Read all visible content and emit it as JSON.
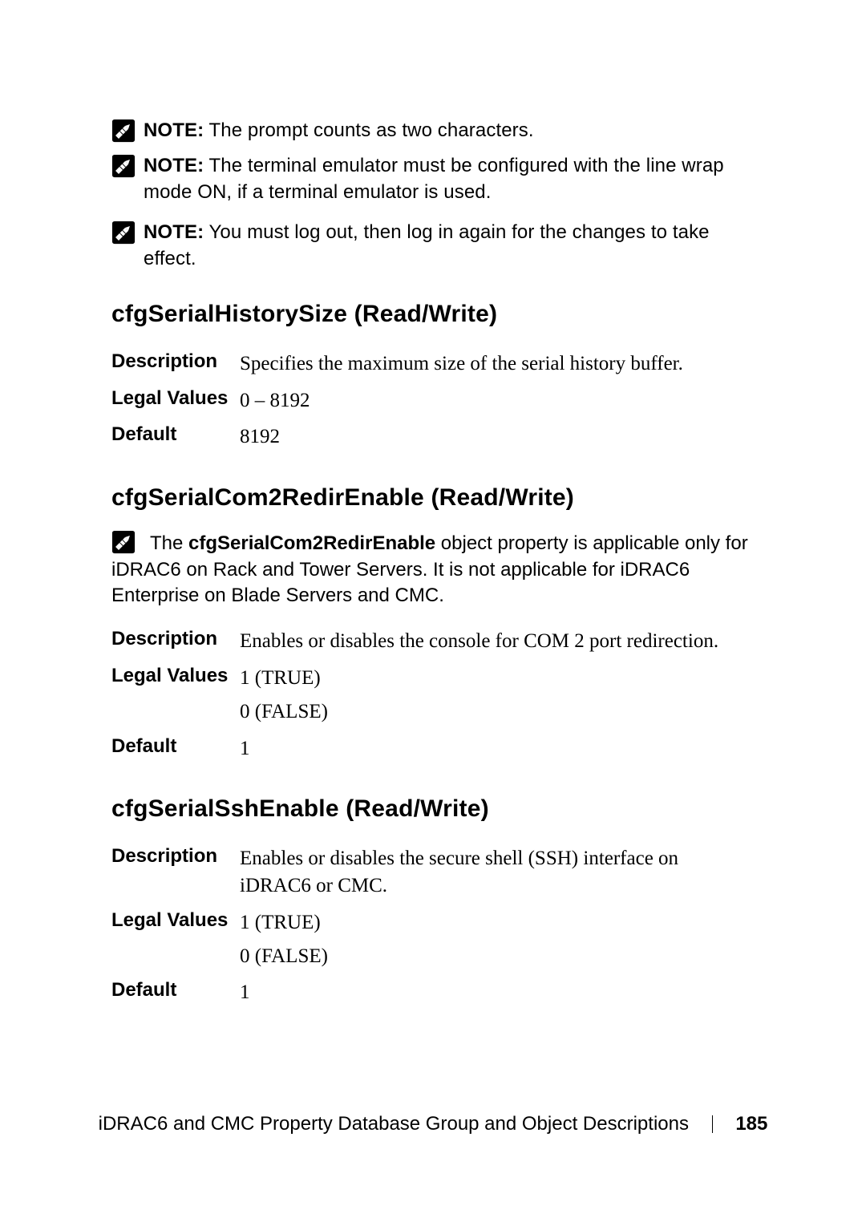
{
  "notes": {
    "n1": {
      "lead": "NOTE:",
      "text": " The prompt counts as two characters."
    },
    "n2": {
      "lead": "NOTE:",
      "text": " The terminal emulator must be configured with the line wrap mode ON, if a terminal emulator is used."
    },
    "n3": {
      "lead": "NOTE:",
      "text": " You must log out, then log in again for the changes to take effect."
    }
  },
  "sections": {
    "s1": {
      "heading": "cfgSerialHistorySize (Read/Write)",
      "rows": {
        "description": {
          "k": "Description",
          "v": "Specifies the maximum size of the serial history buffer."
        },
        "legal": {
          "k": "Legal Values",
          "v": "0 – 8192"
        },
        "default": {
          "k": "Default",
          "v": "8192"
        }
      }
    },
    "s2": {
      "heading": "cfgSerialCom2RedirEnable (Read/Write)",
      "note": {
        "pre": "The ",
        "bold": "cfgSerialCom2RedirEnable",
        "post": " object property is applicable only for iDRAC6 on Rack and Tower Servers. It is not applicable for iDRAC6 Enterprise on Blade Servers and CMC."
      },
      "rows": {
        "description": {
          "k": "Description",
          "v": "Enables or disables the console for COM 2 port redirection."
        },
        "legal": {
          "k": "Legal Values",
          "v1": "1 (TRUE)",
          "v2": "0 (FALSE)"
        },
        "default": {
          "k": "Default",
          "v": "1"
        }
      }
    },
    "s3": {
      "heading": "cfgSerialSshEnable (Read/Write)",
      "rows": {
        "description": {
          "k": "Description",
          "v": "Enables or disables the secure shell (SSH) interface on iDRAC6 or CMC."
        },
        "legal": {
          "k": "Legal Values",
          "v1": "1 (TRUE)",
          "v2": "0 (FALSE)"
        },
        "default": {
          "k": "Default",
          "v": "1"
        }
      }
    }
  },
  "footer": {
    "title": "iDRAC6 and CMC Property Database Group and Object Descriptions",
    "page": "185"
  }
}
